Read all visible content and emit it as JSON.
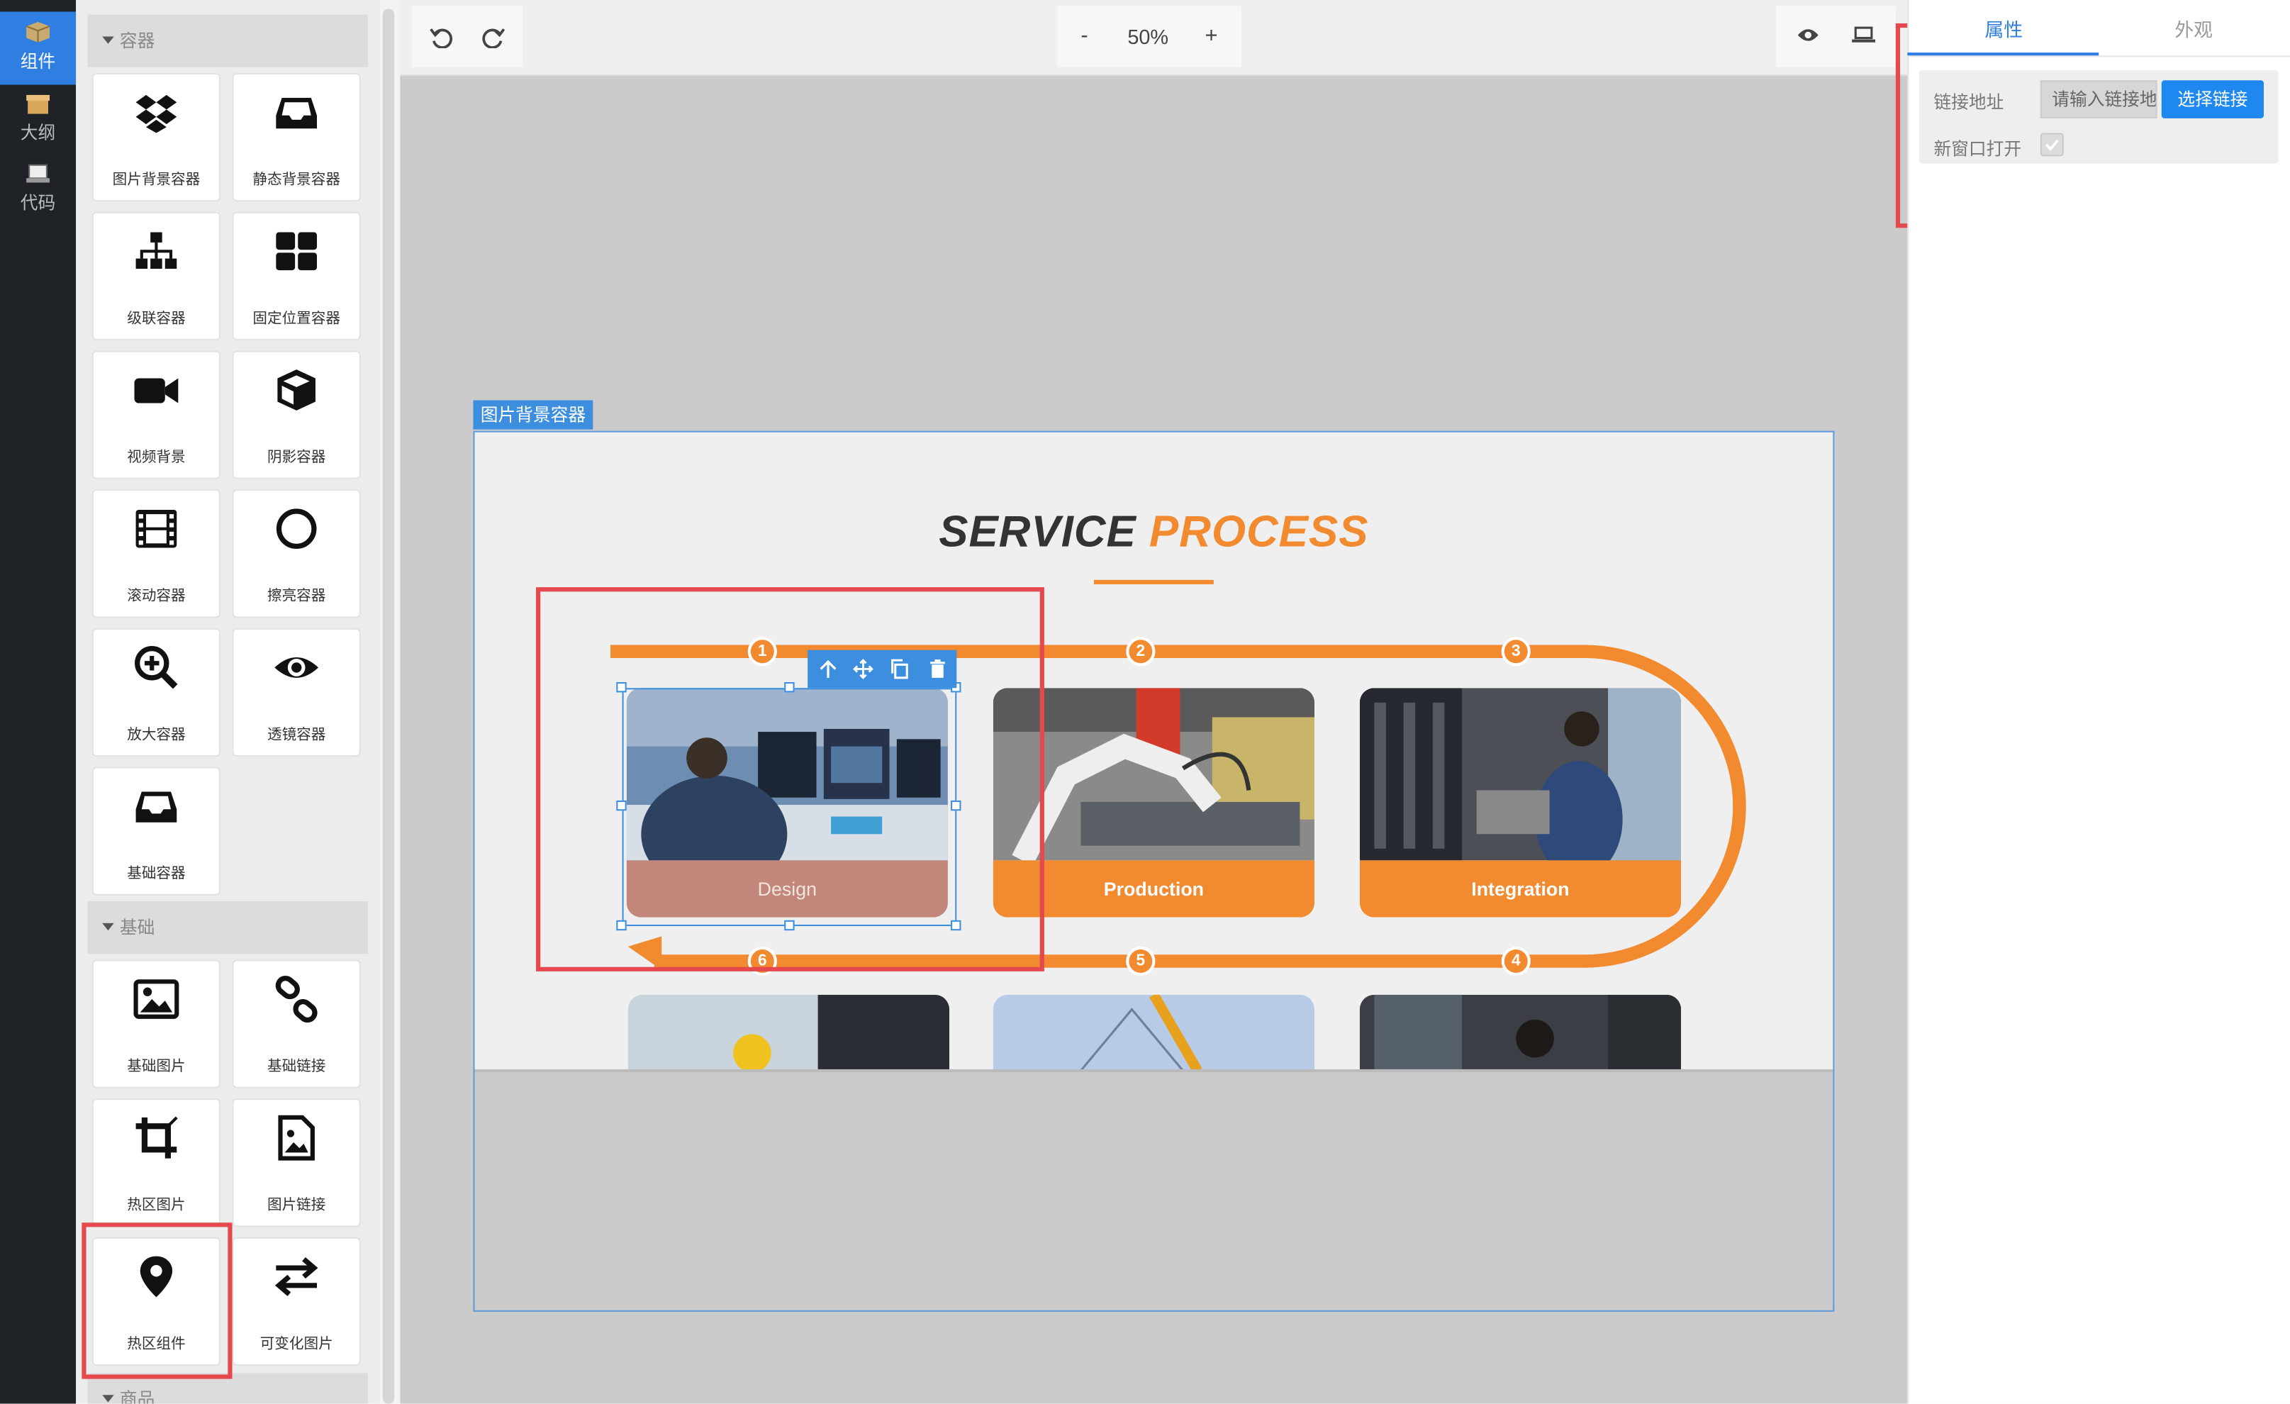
{
  "rail": {
    "items": [
      {
        "label": "组件",
        "icon": "package-icon"
      },
      {
        "label": "大纲",
        "icon": "box-icon"
      },
      {
        "label": "代码",
        "icon": "laptop-icon"
      }
    ]
  },
  "panel": {
    "sections": {
      "container": "容器",
      "basic": "基础",
      "goods": "商品"
    },
    "container_items": [
      {
        "label": "图片背景容器",
        "icon": "dropbox-icon"
      },
      {
        "label": "静态背景容器",
        "icon": "inbox-icon"
      },
      {
        "label": "级联容器",
        "icon": "sitemap-icon"
      },
      {
        "label": "固定位置容器",
        "icon": "grid-icon"
      },
      {
        "label": "视频背景",
        "icon": "video-icon"
      },
      {
        "label": "阴影容器",
        "icon": "cube-icon"
      },
      {
        "label": "滚动容器",
        "icon": "film-icon"
      },
      {
        "label": "擦亮容器",
        "icon": "circle-icon"
      },
      {
        "label": "放大容器",
        "icon": "zoom-in-icon"
      },
      {
        "label": "透镜容器",
        "icon": "eye-icon"
      },
      {
        "label": "基础容器",
        "icon": "inbox-icon"
      }
    ],
    "basic_items": [
      {
        "label": "基础图片",
        "icon": "image-icon"
      },
      {
        "label": "基础链接",
        "icon": "link-icon"
      },
      {
        "label": "热区图片",
        "icon": "crop-icon"
      },
      {
        "label": "图片链接",
        "icon": "file-image-icon"
      },
      {
        "label": "热区组件",
        "icon": "map-marker-icon"
      },
      {
        "label": "可变化图片",
        "icon": "exchange-icon"
      }
    ]
  },
  "toolbar": {
    "zoom_minus": "-",
    "zoom_value": "50%",
    "zoom_plus": "+"
  },
  "page": {
    "container_label": "图片背景容器",
    "title_part1": "SERVICE",
    "title_part2": "PROCESS",
    "steps": [
      "1",
      "2",
      "3",
      "4",
      "5",
      "6"
    ],
    "cards": [
      {
        "label": "Design"
      },
      {
        "label": "Production"
      },
      {
        "label": "Integration"
      }
    ]
  },
  "right_panel": {
    "tabs": [
      "属性",
      "外观"
    ],
    "link_label": "链接地址",
    "link_placeholder": "请输入链接地址",
    "choose_link": "选择链接",
    "new_window_label": "新窗口打开",
    "new_window_checked": true
  },
  "colors": {
    "accent": "#f28a30",
    "primary": "#2f7fe3",
    "highlight": "#e5484d"
  }
}
